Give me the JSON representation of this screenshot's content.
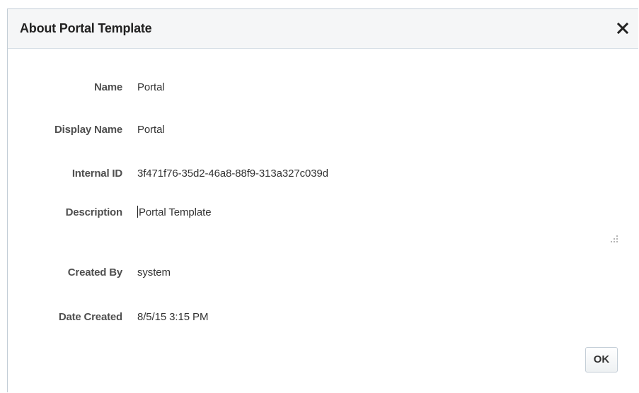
{
  "dialog": {
    "title": "About Portal Template",
    "close_icon": "close-icon"
  },
  "fields": {
    "name": {
      "label": "Name",
      "value": "Portal"
    },
    "display_name": {
      "label": "Display Name",
      "value": "Portal"
    },
    "internal_id": {
      "label": "Internal ID",
      "value": "3f471f76-35d2-46a8-88f9-313a327c039d"
    },
    "description": {
      "label": "Description",
      "value": "Portal Template"
    },
    "created_by": {
      "label": "Created By",
      "value": "system"
    },
    "date_created": {
      "label": "Date Created",
      "value": "8/5/15 3:15 PM"
    }
  },
  "footer": {
    "ok_label": "OK"
  }
}
